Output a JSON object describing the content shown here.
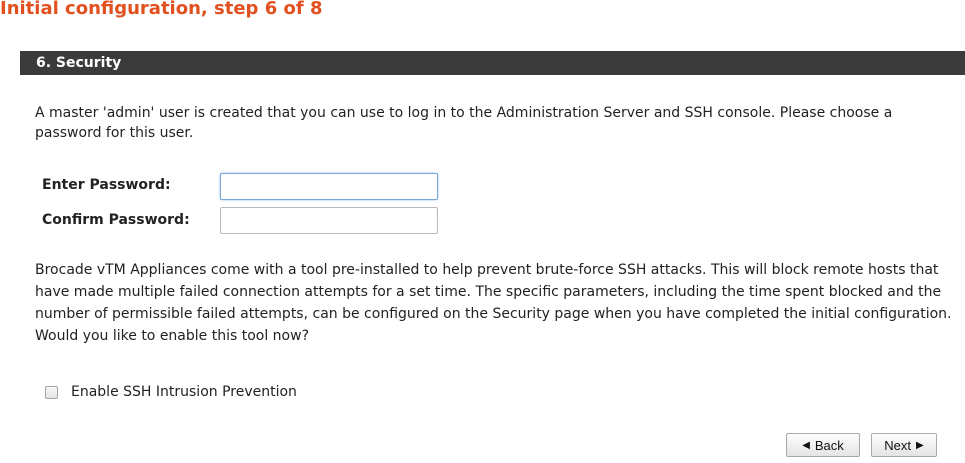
{
  "page": {
    "title": "Initial configuration, step 6 of 8"
  },
  "section": {
    "header": "6. Security",
    "intro": "A master 'admin' user is created that you can use to log in to the Administration Server and SSH console. Please choose a password for this user."
  },
  "form": {
    "enter_password_label": "Enter Password:",
    "enter_password_value": "",
    "confirm_password_label": "Confirm Password:",
    "confirm_password_value": ""
  },
  "ssh": {
    "description": "Brocade vTM Appliances come with a tool pre-installed to help prevent brute-force SSH attacks. This will block remote hosts that have made multiple failed connection attempts for a set time. The specific parameters, including the time spent blocked and the number of permissible failed attempts, can be configured on the Security page when you have completed the initial configuration.",
    "question": "Would you like to enable this tool now?",
    "checkbox_label": "Enable SSH Intrusion Prevention",
    "checkbox_checked": false
  },
  "buttons": {
    "back_label": "Back",
    "next_label": "Next",
    "back_icon": "◀",
    "next_icon": "▶"
  },
  "colors": {
    "title": "#e2501f",
    "header_bg": "#3b3b3b"
  }
}
